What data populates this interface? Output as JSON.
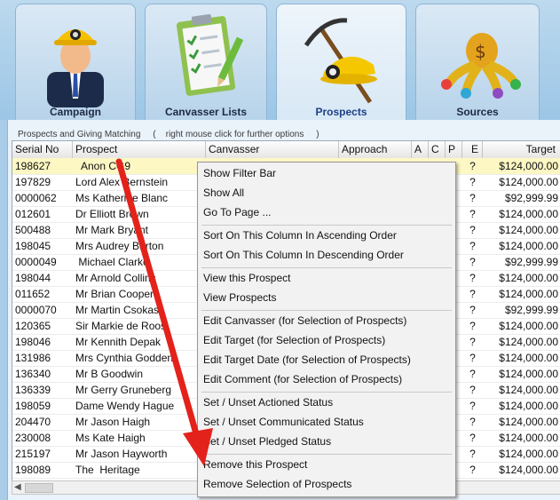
{
  "tabs": [
    {
      "label": "Campaign",
      "icon": "miner-person-icon"
    },
    {
      "label": "Canvasser Lists",
      "icon": "clipboard-checklist-icon"
    },
    {
      "label": "Prospects",
      "icon": "pickaxe-helmet-icon"
    },
    {
      "label": "Sources",
      "icon": "money-bag-fan-icon"
    }
  ],
  "caption": "Prospects and Giving Matching     (    right mouse click for further options     )",
  "columns": [
    "Serial No",
    "Prospect",
    "Canvasser",
    "Approach",
    "A",
    "C",
    "P",
    "E",
    "Target"
  ],
  "rows": [
    {
      "serial": "198627",
      "prospect": "  Anon CG9",
      "e": "?",
      "target": "$124,000.00",
      "selected": true
    },
    {
      "serial": "197829",
      "prospect": "Lord Alex Bernstein",
      "e": "?",
      "target": "$124,000.00"
    },
    {
      "serial": "0000062",
      "prospect": "Ms Katherine Blanc",
      "e": "?",
      "target": "$92,999.99"
    },
    {
      "serial": "012601",
      "prospect": "Dr Elliott Brown",
      "e": "?",
      "target": "$124,000.00"
    },
    {
      "serial": "500488",
      "prospect": "Mr Mark Bryant",
      "e": "?",
      "target": "$124,000.00"
    },
    {
      "serial": "198045",
      "prospect": "Mrs Audrey Burton",
      "e": "?",
      "target": "$124,000.00"
    },
    {
      "serial": "0000049",
      "prospect": " Michael Clarke",
      "e": "?",
      "target": "$92,999.99"
    },
    {
      "serial": "198044",
      "prospect": "Mr Arnold Collins",
      "e": "?",
      "target": "$124,000.00"
    },
    {
      "serial": "011652",
      "prospect": "Mr Brian Cooper",
      "e": "?",
      "target": "$124,000.00"
    },
    {
      "serial": "0000070",
      "prospect": "Mr Martin Csokas",
      "e": "?",
      "target": "$92,999.99"
    },
    {
      "serial": "120365",
      "prospect": "Sir Markie de Roos",
      "e": "?",
      "target": "$124,000.00"
    },
    {
      "serial": "198046",
      "prospect": "Mr Kennith Depak",
      "e": "?",
      "target": "$124,000.00"
    },
    {
      "serial": "131986",
      "prospect": "Mrs Cynthia Godden",
      "e": "?",
      "target": "$124,000.00"
    },
    {
      "serial": "136340",
      "prospect": "Mr B Goodwin",
      "e": "?",
      "target": "$124,000.00"
    },
    {
      "serial": "136339",
      "prospect": "Mr Gerry Gruneberg",
      "e": "?",
      "target": "$124,000.00"
    },
    {
      "serial": "198059",
      "prospect": "Dame Wendy Hague",
      "e": "?",
      "target": "$124,000.00"
    },
    {
      "serial": "204470",
      "prospect": "Mr Jason Haigh",
      "e": "?",
      "target": "$124,000.00"
    },
    {
      "serial": "230008",
      "prospect": "Ms Kate Haigh",
      "e": "?",
      "target": "$124,000.00"
    },
    {
      "serial": "215197",
      "prospect": "Mr Jason Hayworth",
      "e": "?",
      "target": "$124,000.00"
    },
    {
      "serial": "198089",
      "prospect": "The  Heritage",
      "e": "?",
      "target": "$124,000.00"
    }
  ],
  "context_menu": {
    "groups": [
      [
        "Show Filter Bar",
        "Show All",
        "Go To Page ..."
      ],
      [
        "Sort On This Column In Ascending Order",
        "Sort On This Column In Descending Order"
      ],
      [
        "View this Prospect",
        "View Prospects"
      ],
      [
        "Edit Canvasser (for Selection of Prospects)",
        "Edit Target (for Selection of Prospects)",
        "Edit Target Date (for Selection of Prospects)",
        "Edit Comment (for Selection of Prospects)"
      ],
      [
        "Set / Unset Actioned Status",
        "Set / Unset Communicated Status",
        "Set / Unset Pledged Status"
      ],
      [
        "Remove this Prospect",
        "Remove Selection of Prospects"
      ]
    ]
  },
  "colors": {
    "accent_arrow": "#e3221b",
    "selected_row": "#fdf7c4",
    "active_tab_text": "#1d3f87"
  }
}
